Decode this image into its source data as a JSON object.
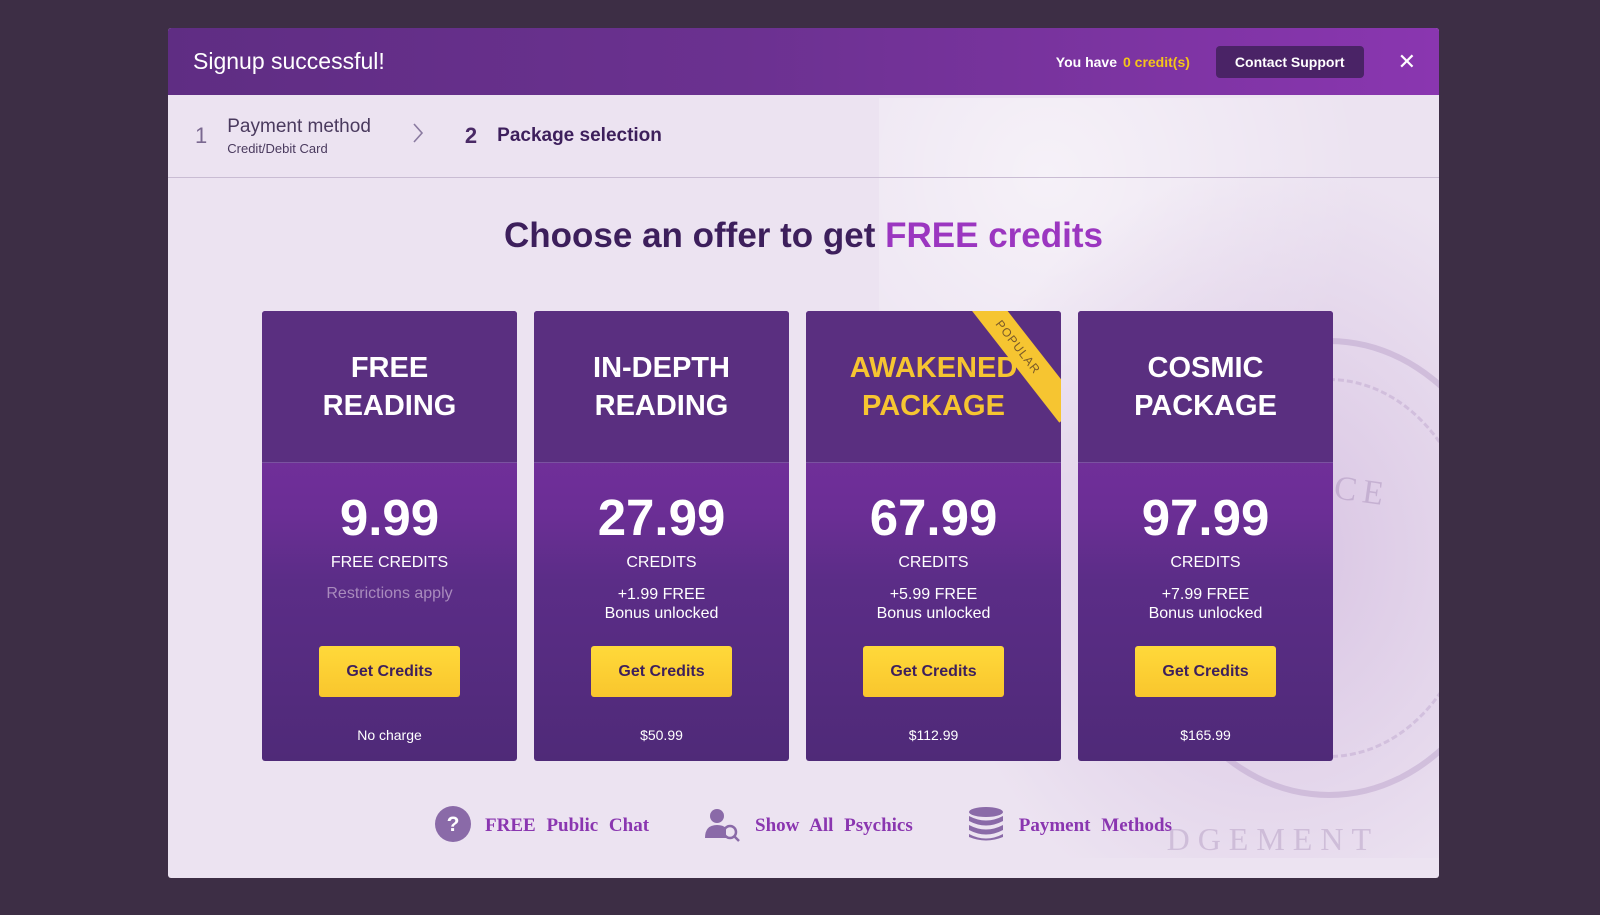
{
  "header": {
    "title": "Signup successful!",
    "credits_prefix": "You have",
    "credits_value": "0 credit(s)",
    "support_label": "Contact Support",
    "close_glyph": "✕"
  },
  "steps": [
    {
      "num": "1",
      "title": "Payment method",
      "sub": "Credit/Debit Card"
    },
    {
      "num": "2",
      "title": "Package selection"
    }
  ],
  "headline": {
    "main": "Choose an offer to get ",
    "highlight": "FREE credits"
  },
  "cards": [
    {
      "line1": "FREE",
      "line2": "READING",
      "price": "9.99",
      "unit": "FREE CREDITS",
      "note": "Restrictions apply",
      "button": "Get Credits",
      "footnote": "No charge"
    },
    {
      "line1": "IN-DEPTH",
      "line2": "READING",
      "price": "27.99",
      "unit": "CREDITS",
      "bonus": "+1.99 FREE",
      "bonus_sub": "Bonus unlocked",
      "button": "Get Credits",
      "footnote": "$50.99"
    },
    {
      "line1": "AWAKENED",
      "line2": "PACKAGE",
      "price": "67.99",
      "unit": "CREDITS",
      "bonus": "+5.99 FREE",
      "bonus_sub": "Bonus unlocked",
      "button": "Get Credits",
      "footnote": "$112.99",
      "ribbon": "POPULAR"
    },
    {
      "line1": "COSMIC",
      "line2": "PACKAGE",
      "price": "97.99",
      "unit": "CREDITS",
      "bonus": "+7.99 FREE",
      "bonus_sub": "Bonus unlocked",
      "button": "Get Credits",
      "footnote": "$165.99"
    }
  ],
  "footer": [
    {
      "label": "FREE Public Chat",
      "icon": "question-icon"
    },
    {
      "label": "Show All Psychics",
      "icon": "user-search-icon"
    },
    {
      "label": "Payment Methods",
      "icon": "coins-stack-icon"
    }
  ],
  "background_watermark": [
    "CE",
    "DGEMENT"
  ],
  "colors": {
    "accent": "#9b36c0",
    "gold": "#f6c531",
    "card": "#5a2f80",
    "page_bg": "#3d2e45"
  }
}
